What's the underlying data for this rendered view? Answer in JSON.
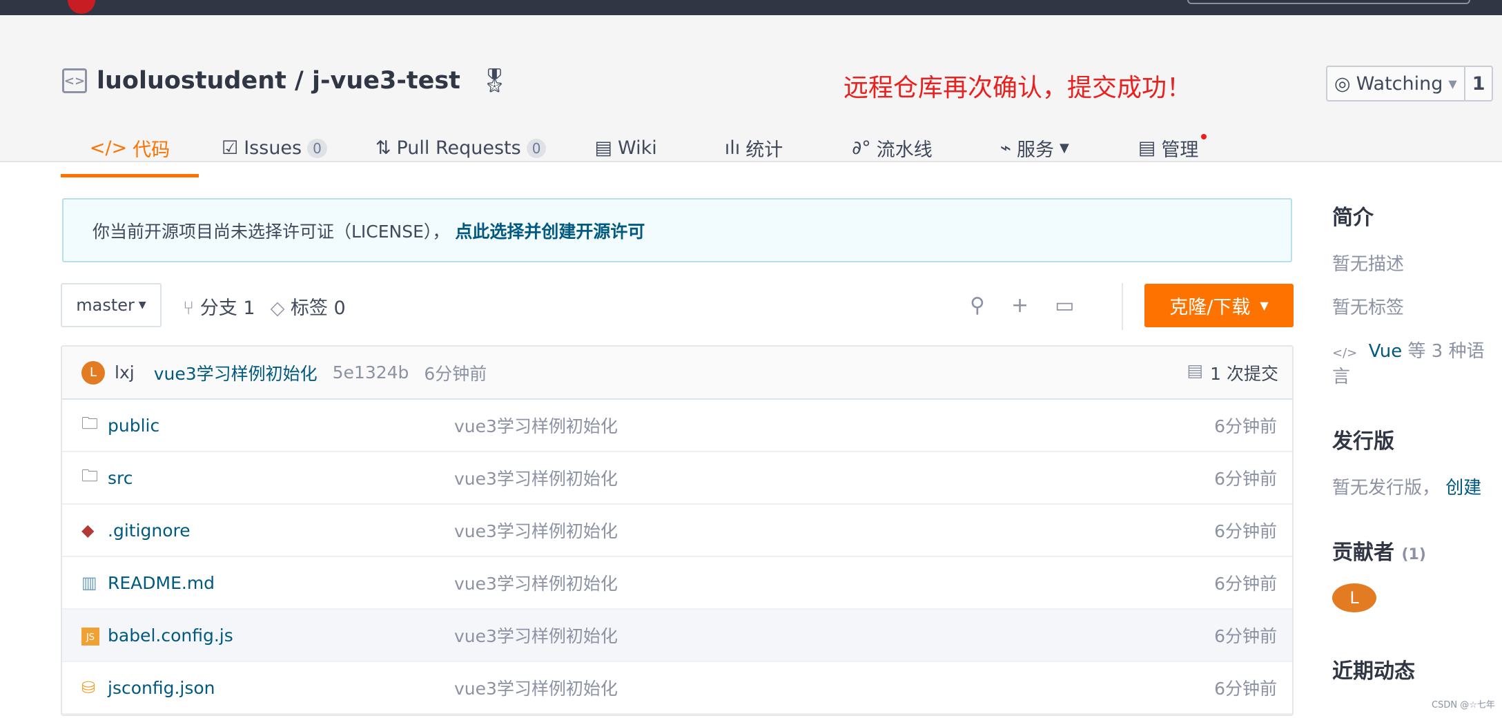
{
  "repo": {
    "owner": "luoluostudent",
    "name": "j-vue3-test",
    "separator": " / "
  },
  "annotation": "远程仓库再次确认，提交成功！",
  "watch": {
    "label": "Watching",
    "count": "1"
  },
  "tabs": [
    {
      "label": "代码",
      "icon": "code-icon"
    },
    {
      "label": "Issues",
      "count": "0",
      "icon": "issues-icon"
    },
    {
      "label": "Pull Requests",
      "count": "0",
      "icon": "pull-request-icon"
    },
    {
      "label": "Wiki",
      "icon": "book-icon"
    },
    {
      "label": "统计",
      "icon": "chart-icon"
    },
    {
      "label": "流水线",
      "icon": "pipeline-icon"
    },
    {
      "label": "服务",
      "icon": "pulse-icon"
    },
    {
      "label": "管理",
      "icon": "settings-doc-icon"
    }
  ],
  "notice": {
    "text": "你当前开源项目尚未选择许可证（LICENSE），",
    "link": "点此选择并创建开源许可"
  },
  "branch": {
    "selected": "master",
    "branches_label": "分支 1",
    "tags_label": "标签 0"
  },
  "clone_label": "克隆/下载",
  "commit": {
    "avatar": "L",
    "author": "lxj",
    "message": "vue3学习样例初始化",
    "hash": "5e1324b",
    "time": "6分钟前",
    "count_label": "1 次提交"
  },
  "files": [
    {
      "name": "public",
      "icon": "folder-icon",
      "message": "vue3学习样例初始化",
      "time": "6分钟前"
    },
    {
      "name": "src",
      "icon": "folder-icon",
      "message": "vue3学习样例初始化",
      "time": "6分钟前"
    },
    {
      "name": ".gitignore",
      "icon": "git-icon",
      "message": "vue3学习样例初始化",
      "time": "6分钟前"
    },
    {
      "name": "README.md",
      "icon": "readme-icon",
      "message": "vue3学习样例初始化",
      "time": "6分钟前"
    },
    {
      "name": "babel.config.js",
      "icon": "js-icon",
      "message": "vue3学习样例初始化",
      "time": "6分钟前"
    },
    {
      "name": "jsconfig.json",
      "icon": "database-icon",
      "message": "vue3学习样例初始化",
      "time": "6分钟前"
    }
  ],
  "sidebar": {
    "intro_title": "简介",
    "no_desc": "暂无描述",
    "no_tags": "暂无标签",
    "lang_link": "Vue",
    "lang_rest": "等 3 种语言",
    "release_title": "发行版",
    "no_release": "暂无发行版，",
    "create": "创建",
    "contributors_title": "贡献者",
    "contributors_count": "(1)",
    "contributor_avatar": "L",
    "recent_title": "近期动态"
  },
  "watermark": "CSDN @☆七年",
  "colors": {
    "accent": "#fe7300",
    "link": "#005980",
    "annotation": "#e8201e"
  }
}
